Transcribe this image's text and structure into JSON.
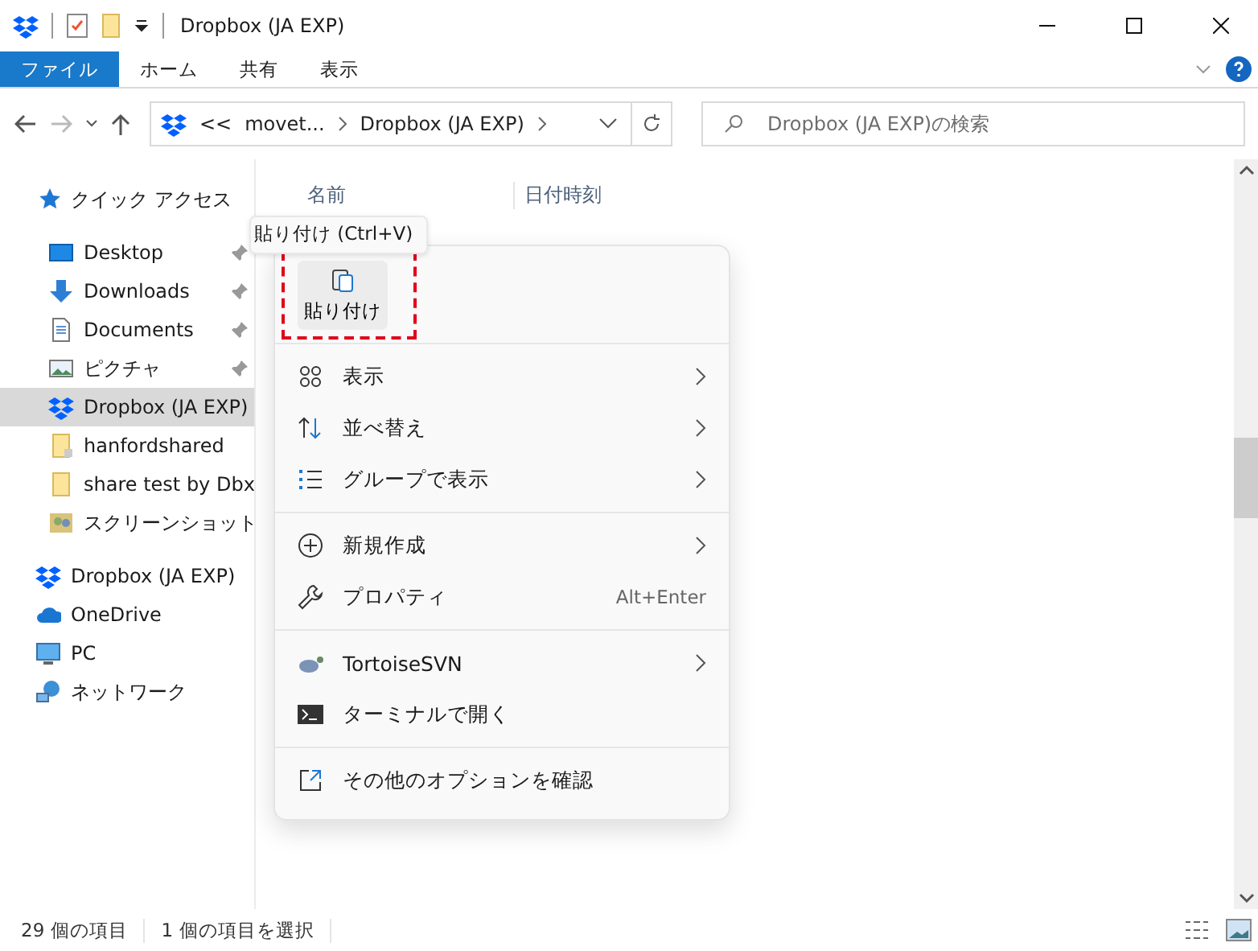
{
  "window": {
    "title": "Dropbox (JA EXP)"
  },
  "ribbon": {
    "tabs": [
      {
        "label": "ファイル",
        "selected": true
      },
      {
        "label": "ホーム",
        "selected": false
      },
      {
        "label": "共有",
        "selected": false
      },
      {
        "label": "表示",
        "selected": false
      }
    ]
  },
  "address_bar": {
    "overflow": "<<",
    "crumbs": [
      "movet...",
      "Dropbox (JA EXP)"
    ]
  },
  "search": {
    "placeholder": "Dropbox (JA EXP)の検索"
  },
  "sidebar": {
    "items": [
      {
        "label": "クイック アクセス",
        "kind": "quick-access",
        "selected": false,
        "children": [
          {
            "label": "Desktop",
            "kind": "desktop",
            "pinned": true,
            "selected": false
          },
          {
            "label": "Downloads",
            "kind": "downloads",
            "pinned": true,
            "selected": false
          },
          {
            "label": "Documents",
            "kind": "documents",
            "pinned": true,
            "selected": false
          },
          {
            "label": "ピクチャ",
            "kind": "pictures",
            "pinned": true,
            "selected": false
          },
          {
            "label": "Dropbox (JA EXP)",
            "kind": "dropbox",
            "pinned": false,
            "selected": true
          },
          {
            "label": "hanfordshared",
            "kind": "shared-folder",
            "pinned": false,
            "selected": false
          },
          {
            "label": "share test by Dbx",
            "kind": "folder",
            "pinned": false,
            "selected": false
          },
          {
            "label": "スクリーンショット",
            "kind": "screenshots",
            "pinned": false,
            "selected": false
          }
        ]
      },
      {
        "label": "Dropbox (JA EXP)",
        "kind": "dropbox",
        "selected": false
      },
      {
        "label": "OneDrive",
        "kind": "onedrive",
        "selected": false
      },
      {
        "label": "PC",
        "kind": "pc",
        "selected": false
      },
      {
        "label": "ネットワーク",
        "kind": "network",
        "selected": false
      }
    ]
  },
  "file_list": {
    "columns": [
      "名前",
      "日付時刻"
    ]
  },
  "tooltip": "貼り付け (Ctrl+V)",
  "context_menu": {
    "top_action": {
      "label": "貼り付け",
      "highlighted": true
    },
    "groups": [
      [
        {
          "label": "表示",
          "kind": "view",
          "submenu": true
        },
        {
          "label": "並べ替え",
          "kind": "sort",
          "submenu": true
        },
        {
          "label": "グループで表示",
          "kind": "group",
          "submenu": true
        }
      ],
      [
        {
          "label": "新規作成",
          "kind": "new",
          "submenu": true
        },
        {
          "label": "プロパティ",
          "kind": "properties",
          "submenu": false,
          "shortcut": "Alt+Enter"
        }
      ],
      [
        {
          "label": "TortoiseSVN",
          "kind": "tortoise",
          "submenu": true
        },
        {
          "label": "ターミナルで開く",
          "kind": "terminal",
          "submenu": false
        }
      ],
      [
        {
          "label": "その他のオプションを確認",
          "kind": "more",
          "submenu": false
        }
      ]
    ]
  },
  "status_bar": {
    "item_count": "29 個の項目",
    "selection": "1 個の項目を選択"
  }
}
